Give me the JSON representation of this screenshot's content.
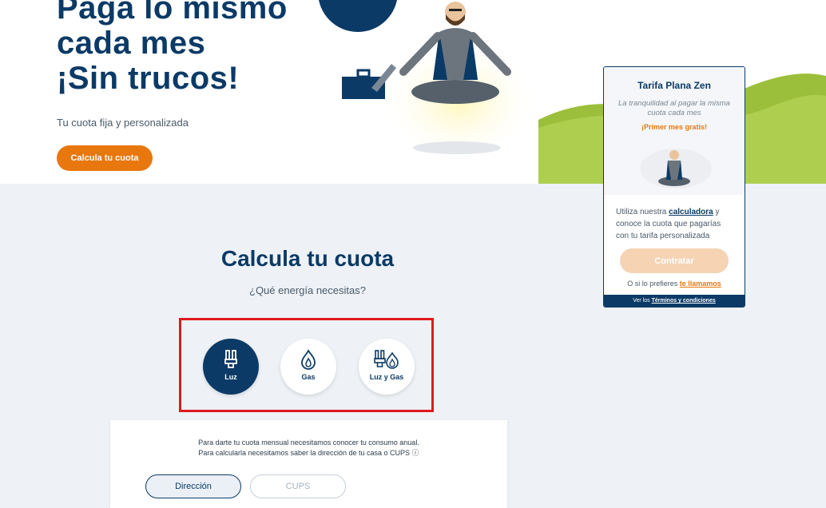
{
  "hero": {
    "title_lines": [
      "Paga lo mismo",
      "cada mes",
      "¡Sin trucos!"
    ],
    "subtitle": "Tu cuota fija y personalizada",
    "cta_label": "Calcula tu cuota"
  },
  "promo": {
    "title": "Tarifa Plana Zen",
    "tagline": "La tranquilidad al pagar la misma cuota cada mes",
    "free_month": "¡Primer mes gratis!",
    "body_prefix": "Utiliza nuestra",
    "body_link": "calculadora",
    "body_suffix": "y conoce la cuota que pagarías con tu tarifa personalizada",
    "contract_label": "Contratar",
    "call_prefix": "O si lo prefieres",
    "call_link": "te llamamos",
    "terms_prefix": "Ver los",
    "terms_link": "Términos y condiciones"
  },
  "calculator": {
    "title": "Calcula tu cuota",
    "question": "¿Qué energía necesitas?",
    "options": [
      {
        "label": "Luz",
        "icon": "bulb-icon",
        "selected": true
      },
      {
        "label": "Gas",
        "icon": "flame-icon",
        "selected": false
      },
      {
        "label": "Luz y Gas",
        "icon": "bulb-flame-icon",
        "selected": false
      }
    ],
    "info_line1": "Para darte tu cuota mensual necesitamos conocer tu consumo anual.",
    "info_line2": "Para calcularla necesitamos saber la dirección de tu casa o CUPS ⓘ",
    "tabs": [
      "Dirección",
      "CUPS"
    ]
  },
  "colors": {
    "brand_blue": "#0b3a66",
    "accent_orange": "#e8770e",
    "highlight_red": "#e0191e"
  }
}
